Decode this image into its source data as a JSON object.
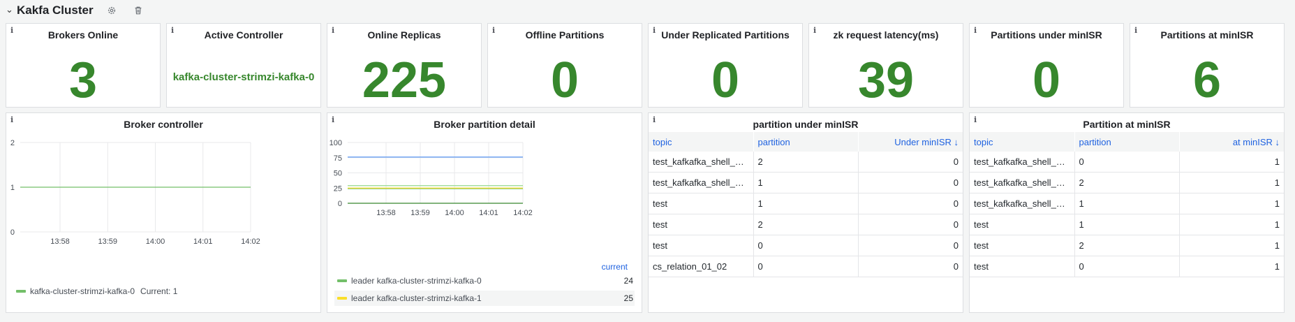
{
  "row": {
    "title": "Kakfa Cluster",
    "chevron": "chevron-down-icon",
    "icons": [
      "gear-icon",
      "trash-icon"
    ]
  },
  "stats": [
    {
      "title": "Brokers Online",
      "value": "3"
    },
    {
      "title": "Active Controller",
      "value": "kafka-cluster-strimzi-kafka-0"
    },
    {
      "title": "Online Replicas",
      "value": "225"
    },
    {
      "title": "Offline Partitions",
      "value": "0"
    },
    {
      "title": "Under Replicated Partitions",
      "value": "0"
    },
    {
      "title": "zk request latency(ms)",
      "value": "39"
    },
    {
      "title": "Partitions under minISR",
      "value": "0"
    },
    {
      "title": "Partitions at minISR",
      "value": "6"
    }
  ],
  "colors": {
    "stat_green": "#37872d",
    "series_green": "#73bf69",
    "series_yellow": "#fade2a",
    "series_blue": "#5794f2",
    "series_lightgreen": "#96d98d",
    "link_blue": "#1f62e0"
  },
  "broker_controller": {
    "title": "Broker controller",
    "legend": [
      {
        "name": "kafka-cluster-strimzi-kafka-0",
        "current": "Current: 1",
        "color": "#73bf69"
      }
    ]
  },
  "broker_partition": {
    "title": "Broker partition detail",
    "legend_header": "current",
    "legend": [
      {
        "name": "leader kafka-cluster-strimzi-kafka-0",
        "value": "24",
        "color": "#73bf69"
      },
      {
        "name": "leader kafka-cluster-strimzi-kafka-1",
        "value": "25",
        "color": "#fade2a"
      }
    ]
  },
  "chart_data": [
    {
      "type": "line",
      "title": "Broker controller",
      "x": [
        "13:58",
        "13:59",
        "14:00",
        "14:01",
        "14:02"
      ],
      "ylim": [
        0,
        2
      ],
      "yticks": [
        0,
        1,
        2
      ],
      "grid": true,
      "legend_placement": "bottom",
      "series": [
        {
          "name": "kafka-cluster-strimzi-kafka-0",
          "values": [
            1,
            1,
            1,
            1,
            1
          ],
          "color": "#73bf69"
        }
      ]
    },
    {
      "type": "line",
      "title": "Broker partition detail",
      "x": [
        "13:58",
        "13:59",
        "14:00",
        "14:01",
        "14:02"
      ],
      "ylim": [
        0,
        100
      ],
      "yticks": [
        0,
        25,
        50,
        75,
        100
      ],
      "grid": true,
      "legend_placement": "bottom",
      "series": [
        {
          "name": "leader kafka-cluster-strimzi-kafka-0",
          "values": [
            24,
            24,
            24,
            24,
            24
          ],
          "color": "#73bf69"
        },
        {
          "name": "leader kafka-cluster-strimzi-kafka-1",
          "values": [
            25,
            25,
            25,
            25,
            25
          ],
          "color": "#fade2a"
        },
        {
          "values": [
            76,
            76,
            76,
            76,
            76
          ],
          "color": "#5794f2"
        },
        {
          "values": [
            29,
            29,
            29,
            29,
            29
          ],
          "color": "#96d98d"
        },
        {
          "values": [
            0,
            0,
            0,
            0,
            0
          ],
          "color": "#37872d"
        }
      ]
    }
  ],
  "tables": [
    {
      "title": "partition under minISR",
      "columns": [
        "topic",
        "partition",
        "Under minISR ↓"
      ],
      "rows": [
        [
          "test_kafkafka_shell_deploy",
          "2",
          "0"
        ],
        [
          "test_kafkafka_shell_deploy",
          "1",
          "0"
        ],
        [
          "test",
          "1",
          "0"
        ],
        [
          "test",
          "2",
          "0"
        ],
        [
          "test",
          "0",
          "0"
        ],
        [
          "cs_relation_01_02",
          "0",
          "0"
        ]
      ]
    },
    {
      "title": "Partition at minISR",
      "columns": [
        "topic",
        "partition",
        "at minISR ↓"
      ],
      "rows": [
        [
          "test_kafkafka_shell_deploy",
          "0",
          "1"
        ],
        [
          "test_kafkafka_shell_deploy",
          "2",
          "1"
        ],
        [
          "test_kafkafka_shell_deploy",
          "1",
          "1"
        ],
        [
          "test",
          "1",
          "1"
        ],
        [
          "test",
          "2",
          "1"
        ],
        [
          "test",
          "0",
          "1"
        ]
      ]
    }
  ]
}
